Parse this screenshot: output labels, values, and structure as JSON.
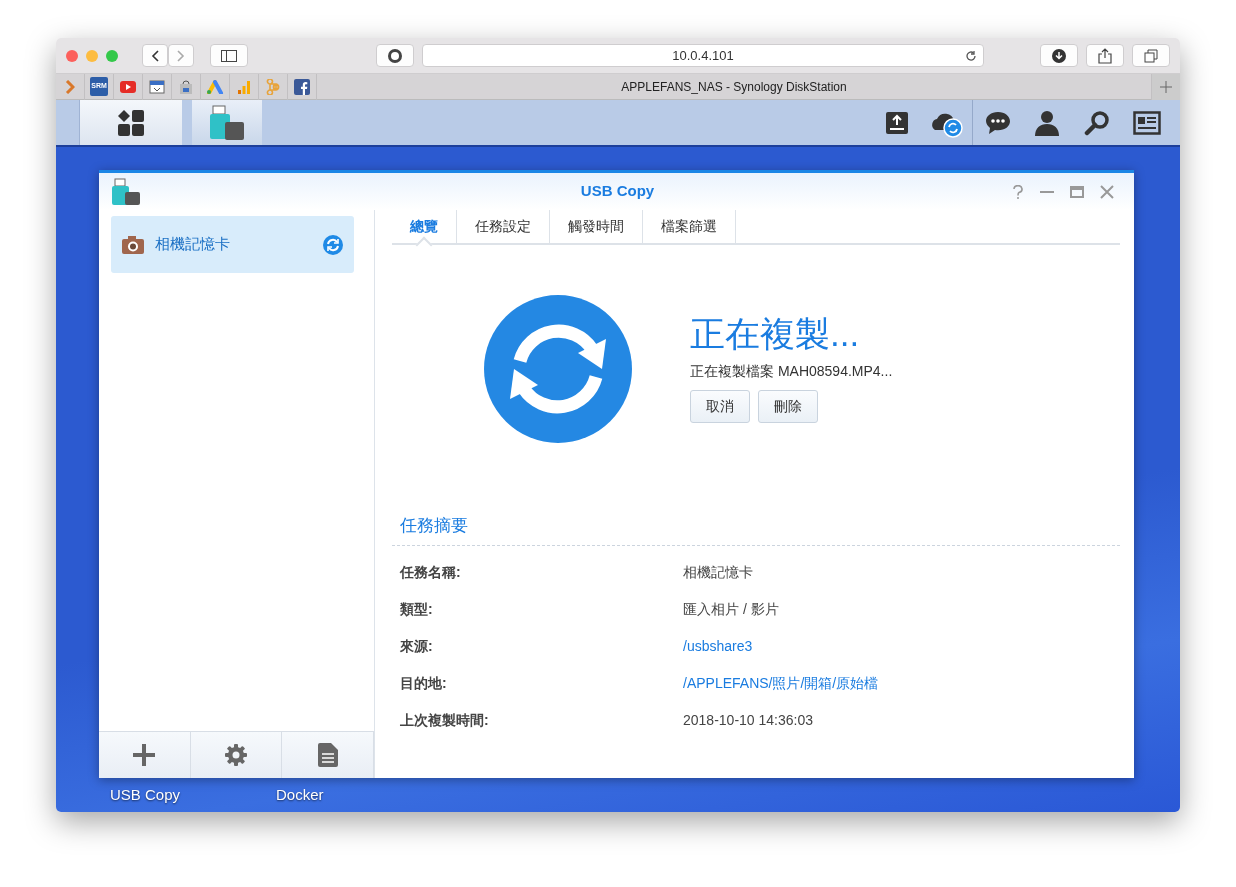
{
  "browser": {
    "address": "10.0.4.101",
    "tab_title": "APPLEFANS_NAS - Synology DiskStation",
    "bookmarks": [
      {
        "kind": "chevron"
      },
      {
        "kind": "srm",
        "label": "SRM"
      },
      {
        "kind": "video"
      },
      {
        "kind": "calendar"
      },
      {
        "kind": "bag"
      },
      {
        "kind": "ads"
      },
      {
        "kind": "analytics"
      },
      {
        "kind": "command"
      },
      {
        "kind": "facebook"
      }
    ]
  },
  "taskbar": {
    "apps": [
      {
        "kind": "main-menu",
        "selected": false
      },
      {
        "kind": "usb-copy",
        "selected": true
      }
    ],
    "tools": [
      {
        "kind": "upload"
      },
      {
        "kind": "cloud-sync"
      },
      {
        "kind": "chat"
      },
      {
        "kind": "user"
      },
      {
        "kind": "search"
      },
      {
        "kind": "widgets"
      }
    ]
  },
  "app_window": {
    "title": "USB Copy",
    "controls": [
      {
        "kind": "help"
      },
      {
        "kind": "minimize"
      },
      {
        "kind": "maximize"
      },
      {
        "kind": "close"
      }
    ],
    "tasks": [
      {
        "name": "相機記憶卡",
        "selected": true
      }
    ],
    "footer_buttons": [
      {
        "kind": "add"
      },
      {
        "kind": "settings"
      },
      {
        "kind": "log"
      }
    ],
    "tabs": [
      {
        "label": "總覽",
        "selected": true
      },
      {
        "label": "任務設定",
        "selected": false
      },
      {
        "label": "觸發時間",
        "selected": false
      },
      {
        "label": "檔案篩選",
        "selected": false
      }
    ],
    "status": {
      "heading": "正在複製...",
      "detail": "正在複製檔案 MAH08594.MP4...",
      "buttons": [
        "取消",
        "刪除"
      ]
    },
    "summary": {
      "title": "任務摘要",
      "rows": [
        {
          "label": "任務名稱:",
          "value": "相機記憶卡",
          "link": false
        },
        {
          "label": "類型:",
          "value": "匯入相片 / 影片",
          "link": false
        },
        {
          "label": "來源:",
          "value": "/usbshare3",
          "link": true
        },
        {
          "label": "目的地:",
          "value": "/APPLEFANS/照片/開箱/原始檔",
          "link": true
        },
        {
          "label": "上次複製時間:",
          "value": "2018-10-10 14:36:03",
          "link": false
        }
      ]
    }
  },
  "desktop_icons": [
    {
      "label": "USB Copy"
    },
    {
      "label": "Docker"
    }
  ]
}
